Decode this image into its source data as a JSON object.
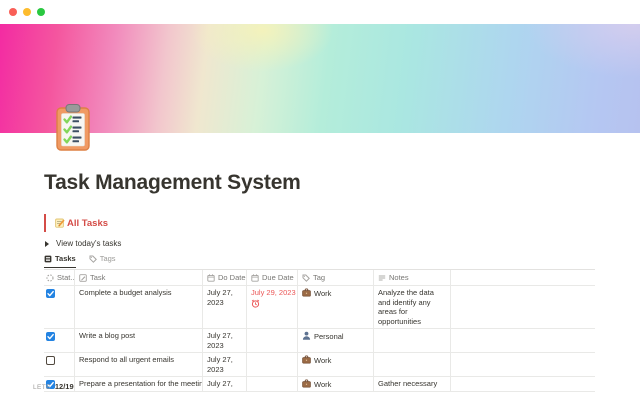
{
  "window": {
    "dots": [
      {
        "name": "close",
        "color": "#f95f57"
      },
      {
        "name": "minimize",
        "color": "#fdbc2e"
      },
      {
        "name": "zoom",
        "color": "#2ac840"
      }
    ]
  },
  "page": {
    "title": "Task Management System",
    "icon": "clipboard-icon",
    "heading": {
      "icon": "memo-icon",
      "label": "All Tasks"
    },
    "toggle_label": "View today's tasks"
  },
  "tabs": [
    {
      "label": "Tasks",
      "icon": "table-view-icon",
      "active": true
    },
    {
      "label": "Tags",
      "icon": "tag-icon",
      "active": false
    }
  ],
  "table": {
    "columns": [
      {
        "label": "Stat...",
        "icon": "status-icon"
      },
      {
        "label": "Task",
        "icon": "pencil-square-icon"
      },
      {
        "label": "Do Date",
        "icon": "calendar-icon"
      },
      {
        "label": "Due Date",
        "icon": "calendar-icon"
      },
      {
        "label": "Tag",
        "icon": "tag-icon"
      },
      {
        "label": "Notes",
        "icon": "notes-icon"
      }
    ],
    "rows": [
      {
        "checked": true,
        "task": "Complete a budget analysis",
        "do_date": "July 27, 2023",
        "due_date": "July 29, 2023",
        "due_reminder": true,
        "tag": "Work",
        "tag_icon": "briefcase-icon",
        "notes": "Analyze the data and identify any areas for opportunities"
      },
      {
        "checked": true,
        "task": "Write a blog post",
        "do_date": "July 27, 2023",
        "due_date": "",
        "due_reminder": false,
        "tag": "Personal",
        "tag_icon": "person-icon",
        "notes": ""
      },
      {
        "checked": false,
        "task": "Respond to all urgent emails",
        "do_date": "July 27, 2023",
        "due_date": "",
        "due_reminder": false,
        "tag": "Work",
        "tag_icon": "briefcase-icon",
        "notes": ""
      },
      {
        "checked": true,
        "task": "Prepare a presentation for the meeting",
        "do_date": "July 27,",
        "due_date": "",
        "due_reminder": false,
        "tag": "Work",
        "tag_icon": "briefcase-icon",
        "notes": "Gather necessary"
      }
    ],
    "footer": {
      "label": "LETE",
      "value": "12/19"
    }
  },
  "colors": {
    "accent_red": "#d44c47",
    "date_red": "#eb5757",
    "checkbox_blue": "#2383e2",
    "text": "#37352f",
    "muted_text": "#787774",
    "border": "#e9e9e7"
  }
}
